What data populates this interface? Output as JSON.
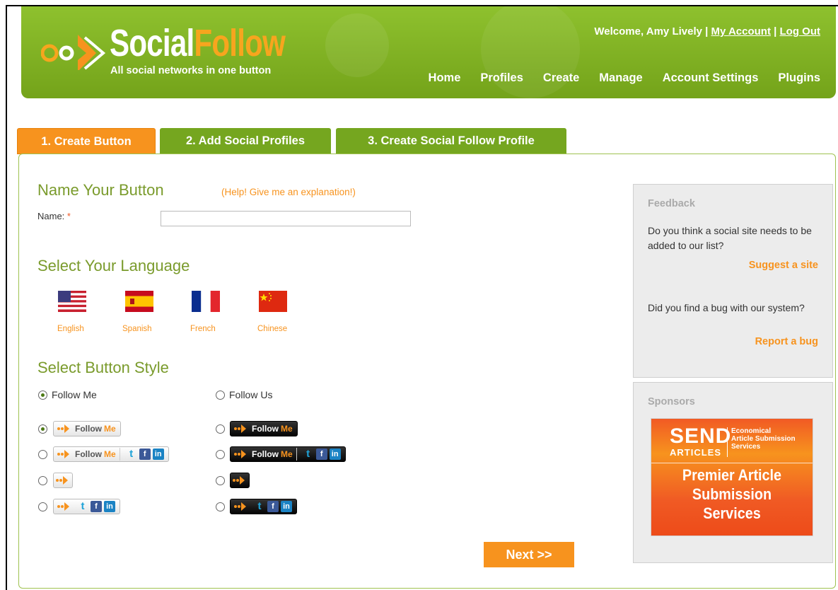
{
  "header": {
    "logo_word1": "Social",
    "logo_word2": "Follow",
    "tagline": "All social networks in one button",
    "welcome": "Welcome, Amy Lively |",
    "my_account": "My Account",
    "divider": "|",
    "logout": "Log Out",
    "nav": [
      "Home",
      "Profiles",
      "Create",
      "Manage",
      "Account Settings",
      "Plugins"
    ]
  },
  "tabs": [
    "1. Create Button",
    "2. Add Social Profiles",
    "3. Create Social Follow Profile"
  ],
  "name_section": {
    "heading": "Name Your Button",
    "help": "(Help! Give me an explanation!)",
    "label": "Name:",
    "required_mark": "*",
    "value": ""
  },
  "language_section": {
    "heading": "Select Your Language",
    "languages": [
      "English",
      "Spanish",
      "French",
      "Chinese"
    ]
  },
  "style_section": {
    "heading": "Select Button Style",
    "options": [
      "Follow Me",
      "Follow Us"
    ],
    "selected_option": "Follow Me",
    "button_follow": "Follow",
    "button_me": "Me"
  },
  "next_button": "Next >>",
  "feedback": {
    "heading": "Feedback",
    "q1": "Do you think a social site needs to be added to our list?",
    "link1": "Suggest a site",
    "q2": "Did you find a bug with our system?",
    "link2": "Report a bug"
  },
  "sponsors": {
    "heading": "Sponsors",
    "ad_send": "SEND",
    "ad_articles": "ARTICLES",
    "ad_sub_1": "Economical",
    "ad_sub_2": "Article Submission",
    "ad_sub_3": "Services",
    "ad_main_1": "Premier Article",
    "ad_main_2": "Submission",
    "ad_main_3": "Services"
  },
  "colors": {
    "brand_green": "#7cae1f",
    "accent_orange": "#f7931e"
  }
}
